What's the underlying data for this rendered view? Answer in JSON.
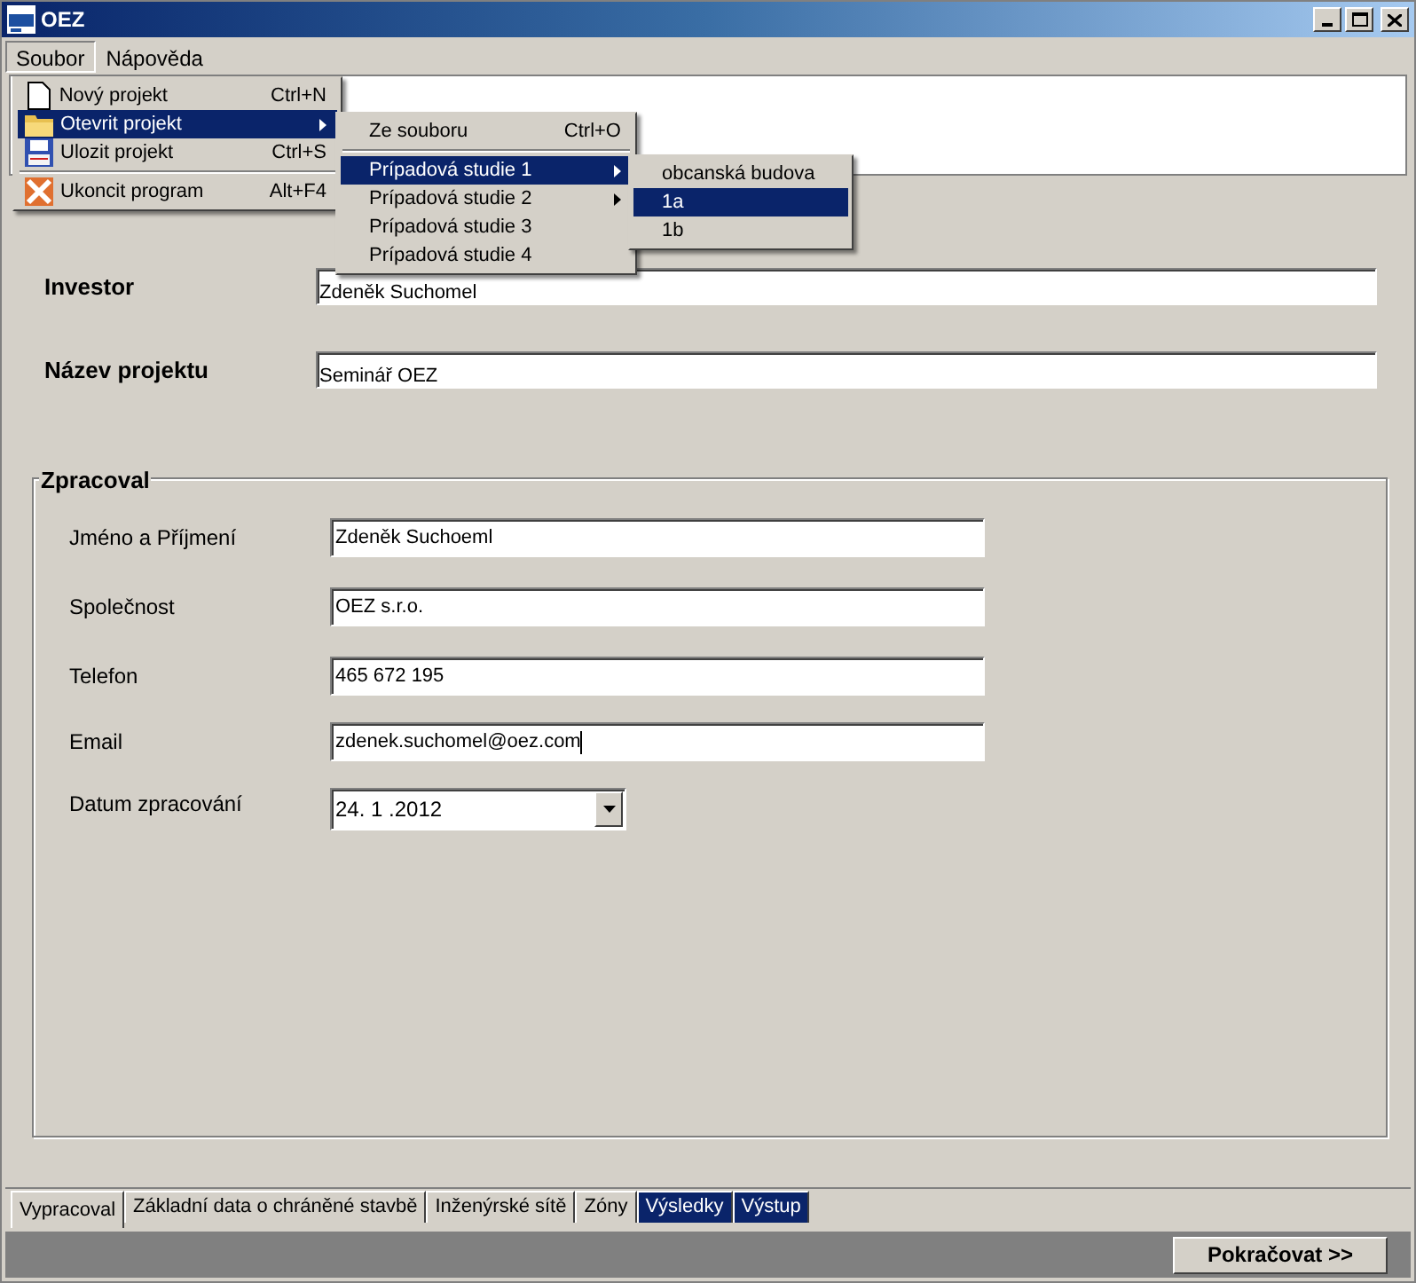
{
  "window": {
    "title": "OEZ"
  },
  "menubar": [
    {
      "label": "Soubor",
      "selected": true
    },
    {
      "label": "Nápověda",
      "selected": false
    }
  ],
  "menus": [
    {
      "items": [
        {
          "kind": "item",
          "label": "Nový projekt",
          "shortcut": "Ctrl+N",
          "selected": false,
          "submenu": false
        },
        {
          "kind": "item",
          "label": "Otevrit projekt",
          "selected": true,
          "submenu": true
        },
        {
          "kind": "item",
          "label": "Ulozit projekt",
          "shortcut": "Ctrl+S",
          "selected": false,
          "submenu": false
        },
        {
          "kind": "separator"
        },
        {
          "kind": "item",
          "label": "Ukoncit program",
          "shortcut": "Alt+F4",
          "selected": false,
          "submenu": false
        }
      ]
    },
    {
      "items": [
        {
          "kind": "item",
          "label": "Ze souboru",
          "shortcut": "Ctrl+O",
          "selected": false,
          "submenu": false
        },
        {
          "kind": "separator"
        },
        {
          "kind": "item",
          "label": "Prípadová studie 1",
          "selected": true,
          "submenu": true
        },
        {
          "kind": "item",
          "label": "Prípadová studie 2",
          "selected": false,
          "submenu": true
        },
        {
          "kind": "item",
          "label": "Prípadová studie 3",
          "selected": false,
          "submenu": false
        },
        {
          "kind": "item",
          "label": "Prípadová studie 4",
          "selected": false,
          "submenu": false
        }
      ]
    },
    {
      "items": [
        {
          "kind": "item",
          "label": "obcanská budova",
          "selected": false,
          "submenu": false
        },
        {
          "kind": "item",
          "label": "1a",
          "selected": true,
          "submenu": false
        },
        {
          "kind": "item",
          "label": "1b",
          "selected": false,
          "submenu": false
        }
      ]
    }
  ],
  "project": [
    {
      "label": "Investor",
      "value": "Zdeněk Suchomel"
    },
    {
      "label": "Název projektu",
      "value": "Seminář OEZ"
    }
  ],
  "group": {
    "title": "Zpracoval",
    "fields": [
      {
        "label": "Jméno a Příjmení",
        "value": "Zdeněk Suchoeml",
        "focused": false
      },
      {
        "label": "Společnost",
        "value": "OEZ s.r.o.",
        "focused": false
      },
      {
        "label": "Telefon",
        "value": "465 672 195",
        "focused": false
      },
      {
        "label": "Email",
        "value": "zdenek.suchomel@oez.com",
        "focused": true
      }
    ],
    "date": {
      "label": "Datum zpracování",
      "value": "24. 1 .2012"
    }
  },
  "tabs": [
    {
      "label": "Vypracoval",
      "selected": true,
      "highlighted": false
    },
    {
      "label": "Základní data o chráněné stavbě",
      "selected": false,
      "highlighted": false
    },
    {
      "label": "Inženýrské sítě",
      "selected": false,
      "highlighted": false
    },
    {
      "label": "Zóny",
      "selected": false,
      "highlighted": false
    },
    {
      "label": "Výsledky",
      "selected": false,
      "highlighted": true
    },
    {
      "label": "Výstup",
      "selected": false,
      "highlighted": true
    }
  ],
  "continue_button": "Pokračovat >>"
}
